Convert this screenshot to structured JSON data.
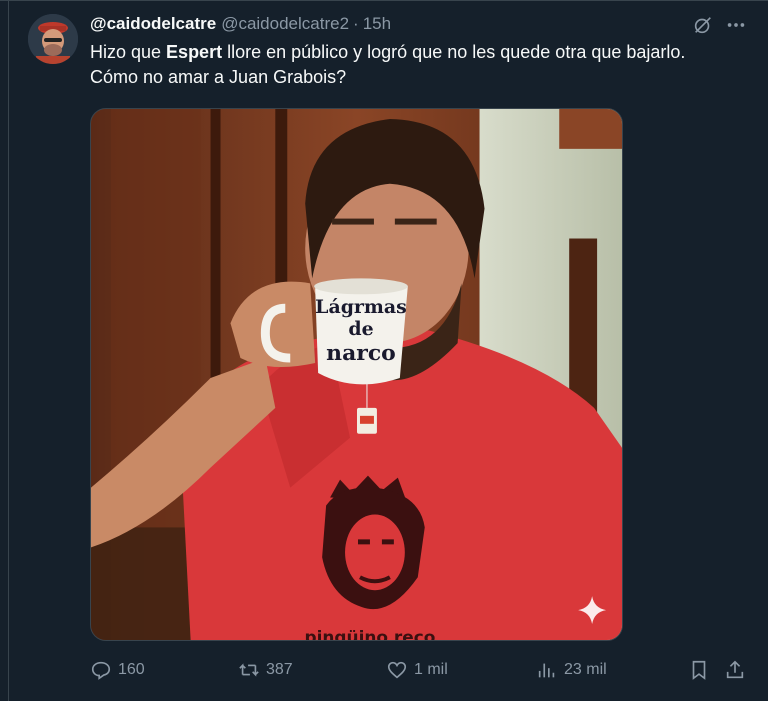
{
  "tweet": {
    "display_name": "@caidodelcatre",
    "handle": "@caidodelcatre2",
    "separator": "·",
    "time": "15h",
    "text": {
      "line1_prefix": "Hizo que ",
      "line1_bold": "Espert",
      "line1_suffix": " llore en público y logró que no les quede otra que bajarlo.",
      "line2": "Cómo no amar a Juan Grabois?"
    },
    "media": {
      "mug_text": [
        "Lágrmas",
        "de",
        "narco"
      ],
      "shirt_text": "pingüino reco"
    }
  },
  "actions": {
    "replies": "160",
    "retweets": "387",
    "likes": "1 mil",
    "views": "23 mil"
  },
  "icons": [
    "grok-icon",
    "more-icon",
    "reply-icon",
    "retweet-icon",
    "like-icon",
    "views-icon",
    "bookmark-icon",
    "share-icon",
    "sparkle-icon"
  ],
  "colors": {
    "background": "#15202b",
    "text": "#f7f9f9",
    "secondary": "#8b98a5",
    "border": "#38444d",
    "shirt": "#d9383a"
  }
}
